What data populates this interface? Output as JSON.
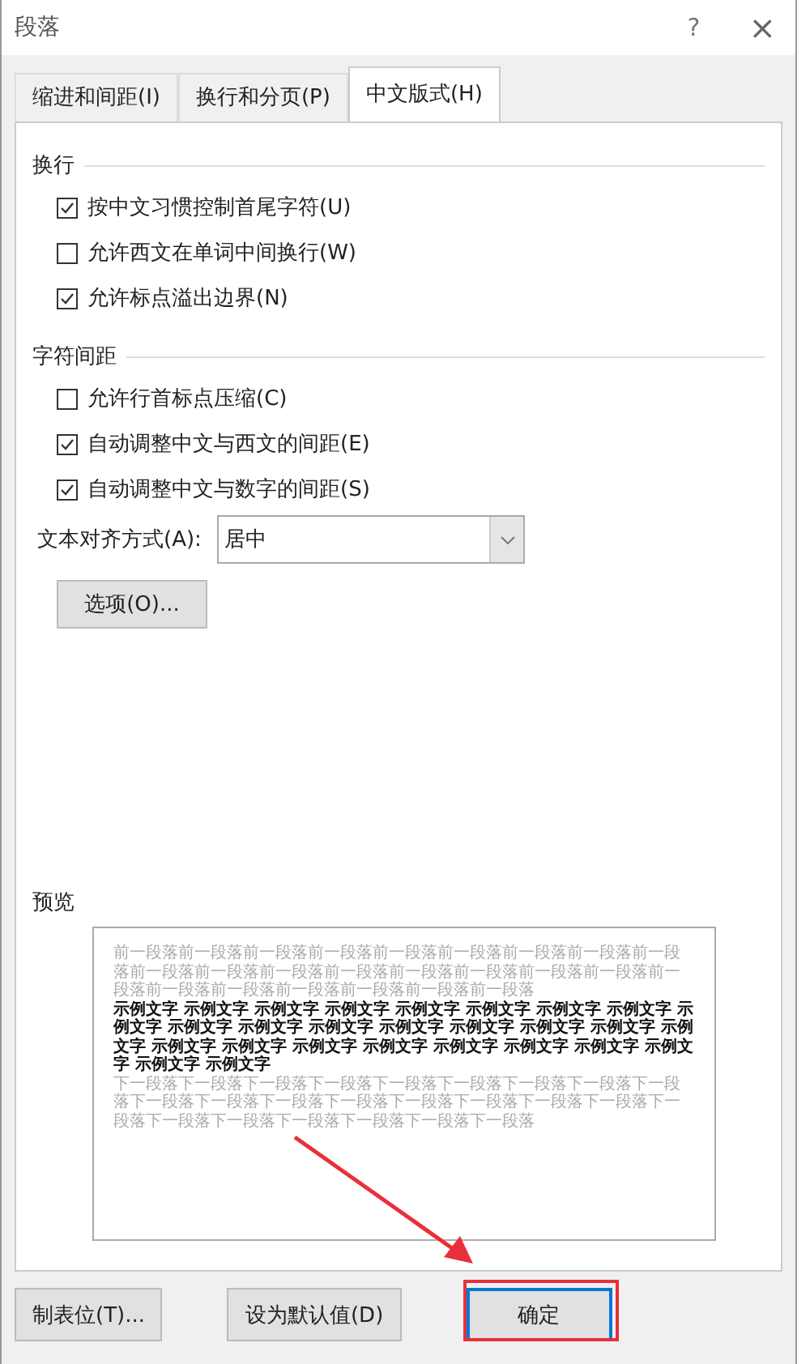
{
  "window": {
    "title": "段落",
    "help": "?",
    "close": "×"
  },
  "tabs": [
    {
      "label": "缩进和间距(I)",
      "selected": false
    },
    {
      "label": "换行和分页(P)",
      "selected": false
    },
    {
      "label": "中文版式(H)",
      "selected": true
    }
  ],
  "sections": [
    {
      "heading": "换行",
      "items": [
        {
          "kind": "checkbox",
          "label": "按中文习惯控制首尾字符(U)",
          "checked": true
        },
        {
          "kind": "checkbox",
          "label": "允许西文在单词中间换行(W)",
          "checked": false
        },
        {
          "kind": "checkbox",
          "label": "允许标点溢出边界(N)",
          "checked": true
        }
      ]
    },
    {
      "heading": "字符间距",
      "items": [
        {
          "kind": "checkbox",
          "label": "允许行首标点压缩(C)",
          "checked": false
        },
        {
          "kind": "checkbox",
          "label": "自动调整中文与西文的间距(E)",
          "checked": true
        },
        {
          "kind": "checkbox",
          "label": "自动调整中文与数字的间距(S)",
          "checked": true
        },
        {
          "kind": "dropdown",
          "label": "文本对齐方式(A):",
          "value": "居中"
        },
        {
          "kind": "button",
          "label": "选项(O)..."
        }
      ]
    }
  ],
  "preview": {
    "heading": "预览",
    "previous_text": "前一段落前一段落前一段落前一段落前一段落前一段落前一段落前一段落前一段落前一段落前一段落前一段落前一段落前一段落前一段落前一段落前一段落前一段落前一段落前一段落前一段落前一段落前一段落前一段落",
    "sample_text": "示例文字 示例文字 示例文字 示例文字 示例文字 示例文字 示例文字 示例文字 示例文字 示例文字 示例文字 示例文字 示例文字 示例文字 示例文字 示例文字 示例文字 示例文字 示例文字 示例文字 示例文字 示例文字 示例文字 示例文字 示例文字 示例文字 示例文字",
    "next_text": "下一段落下一段落下一段落下一段落下一段落下一段落下一段落下一段落下一段落下一段落下一段落下一段落下一段落下一段落下一段落下一段落下一段落下一段落下一段落下一段落下一段落下一段落下一段落下一段落"
  },
  "buttons": [
    {
      "label": "制表位(T)...",
      "default": false
    },
    {
      "label": "设为默认值(D)",
      "default": false
    },
    {
      "label": "确定",
      "default": true
    }
  ]
}
